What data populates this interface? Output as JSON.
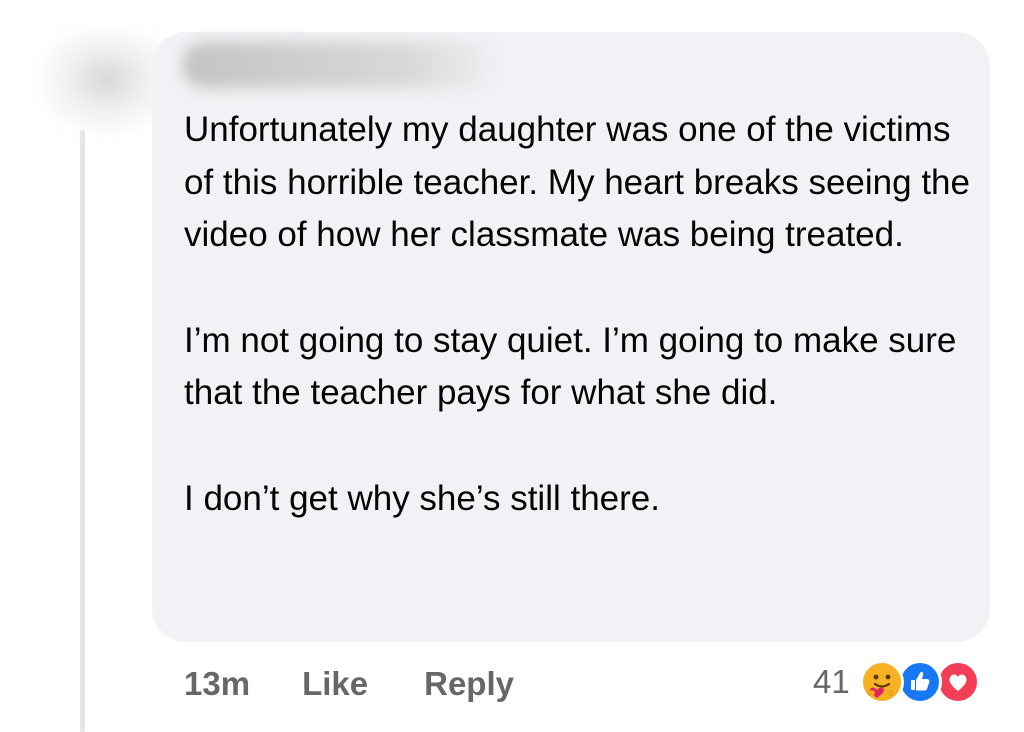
{
  "comment": {
    "paragraphs": [
      "Unfortunately my daughter was one of the victims of this horrible teacher. My heart breaks seeing the video of how her classmate was being treated.",
      "I’m not going to stay quiet. I’m going to make sure that the teacher pays for what she did.",
      "I don’t get why she’s still there."
    ]
  },
  "actions": {
    "timestamp": "13m",
    "like_label": "Like",
    "reply_label": "Reply"
  },
  "reactions": {
    "count": "41",
    "icons": [
      "care-icon",
      "like-icon",
      "love-icon"
    ]
  },
  "colors": {
    "bubble_bg": "#f0f2f5",
    "text": "#050505",
    "secondary_text": "#65676b",
    "like_blue": "#1877f2",
    "love_red": "#f33e58",
    "care_yellow": "#f7b125"
  }
}
